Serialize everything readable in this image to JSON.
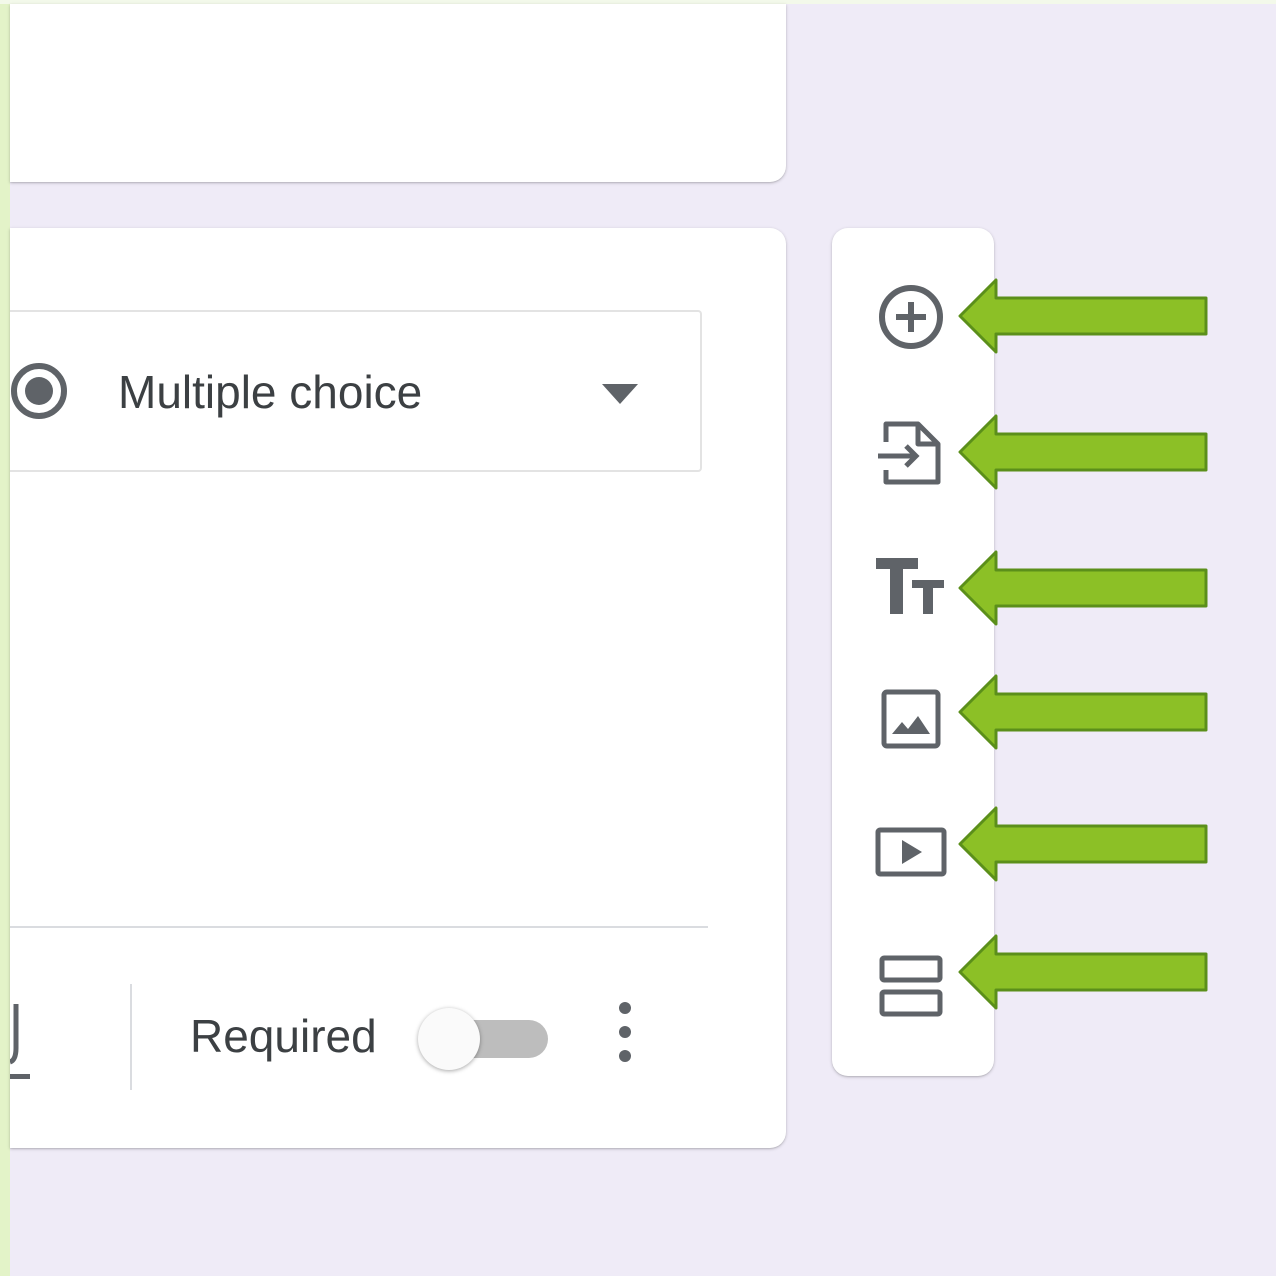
{
  "question_card": {
    "question_type": {
      "selected_label": "Multiple choice"
    },
    "footer": {
      "required_label": "Required",
      "required_on": false
    }
  },
  "toolbar": {
    "items": [
      {
        "icon": "add-circle-icon"
      },
      {
        "icon": "import-questions-icon"
      },
      {
        "icon": "title-text-icon"
      },
      {
        "icon": "image-icon"
      },
      {
        "icon": "video-icon"
      },
      {
        "icon": "section-icon"
      }
    ]
  },
  "annotations": {
    "arrow_color": "#8cc026",
    "arrow_outline_color": "#5b8f1a",
    "arrow_count": 6
  },
  "colors": {
    "background": "#efebf7",
    "card": "#ffffff",
    "icon": "#5f6368",
    "text": "#3c4043"
  }
}
